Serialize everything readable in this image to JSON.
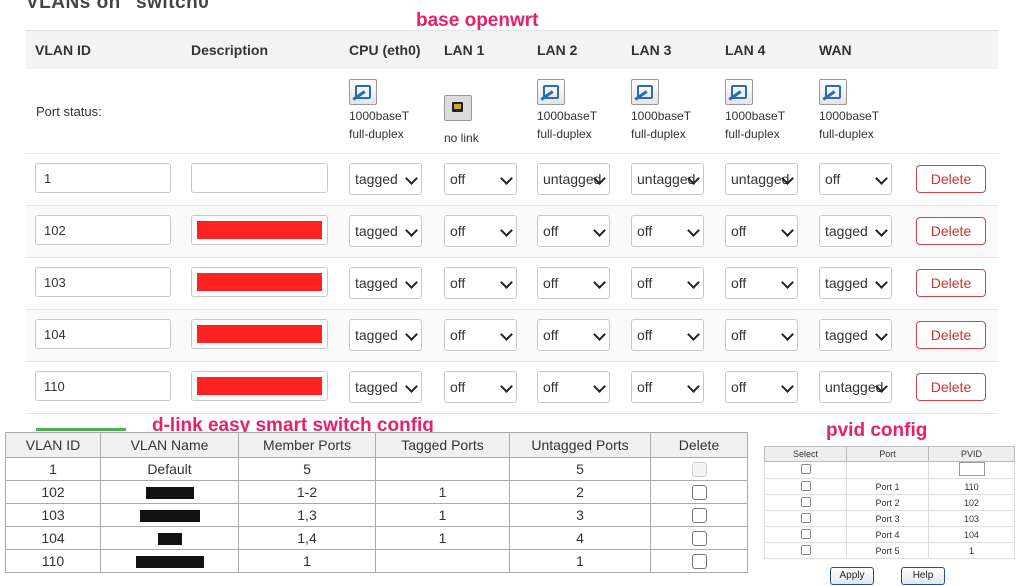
{
  "heading": "VLANs on \"switch0\"",
  "annotations": {
    "top": "base openwrt",
    "middle": "d-link easy smart switch config",
    "right": "pvid config"
  },
  "openwrt": {
    "headers": [
      "VLAN ID",
      "Description",
      "CPU (eth0)",
      "LAN 1",
      "LAN 2",
      "LAN 3",
      "LAN 4",
      "WAN"
    ],
    "port_status_label": "Port status:",
    "ports": [
      {
        "state": "up",
        "line1": "1000baseT",
        "line2": "full-duplex"
      },
      {
        "state": "down",
        "line1": "no link",
        "line2": ""
      },
      {
        "state": "up",
        "line1": "1000baseT",
        "line2": "full-duplex"
      },
      {
        "state": "up",
        "line1": "1000baseT",
        "line2": "full-duplex"
      },
      {
        "state": "up",
        "line1": "1000baseT",
        "line2": "full-duplex"
      },
      {
        "state": "up",
        "line1": "1000baseT",
        "line2": "full-duplex"
      }
    ],
    "delete_label": "Delete",
    "rows": [
      {
        "id": "1",
        "redacted": false,
        "ports": [
          "tagged",
          "off",
          "untagged",
          "untagged",
          "untagged",
          "off"
        ]
      },
      {
        "id": "102",
        "redacted": true,
        "ports": [
          "tagged",
          "off",
          "off",
          "off",
          "off",
          "tagged"
        ]
      },
      {
        "id": "103",
        "redacted": true,
        "ports": [
          "tagged",
          "off",
          "off",
          "off",
          "off",
          "tagged"
        ]
      },
      {
        "id": "104",
        "redacted": true,
        "ports": [
          "tagged",
          "off",
          "off",
          "off",
          "off",
          "tagged"
        ]
      },
      {
        "id": "110",
        "redacted": true,
        "ports": [
          "tagged",
          "off",
          "off",
          "off",
          "off",
          "untagged"
        ]
      }
    ]
  },
  "dlink": {
    "headers": [
      "VLAN ID",
      "VLAN Name",
      "Member Ports",
      "Tagged Ports",
      "Untagged Ports",
      "Delete"
    ],
    "rows": [
      {
        "id": "1",
        "name": "Default",
        "member": "5",
        "tagged": "",
        "untagged": "5",
        "delete_disabled": true
      },
      {
        "id": "102",
        "name": "",
        "member": "1-2",
        "tagged": "1",
        "untagged": "2",
        "delete_disabled": false
      },
      {
        "id": "103",
        "name": "",
        "member": "1,3",
        "tagged": "1",
        "untagged": "3",
        "delete_disabled": false
      },
      {
        "id": "104",
        "name": "",
        "member": "1,4",
        "tagged": "1",
        "untagged": "4",
        "delete_disabled": false
      },
      {
        "id": "110",
        "name": "",
        "member": "1",
        "tagged": "",
        "untagged": "1",
        "delete_disabled": false
      }
    ]
  },
  "pvid": {
    "headers": [
      "Select",
      "Port",
      "PVID"
    ],
    "rows": [
      {
        "port": "Port 1",
        "pvid": "110"
      },
      {
        "port": "Port 2",
        "pvid": "102"
      },
      {
        "port": "Port 3",
        "pvid": "103"
      },
      {
        "port": "Port 4",
        "pvid": "104"
      },
      {
        "port": "Port 5",
        "pvid": "1"
      }
    ],
    "apply_label": "Apply",
    "help_label": "Help"
  }
}
